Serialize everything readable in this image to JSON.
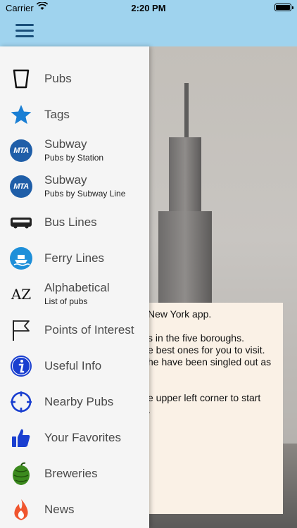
{
  "status": {
    "carrier": "Carrier",
    "time": "2:20 PM"
  },
  "nav": {
    "menu_icon": "hamburger-menu-icon"
  },
  "info_lines": [
    "New York app.",
    "",
    "s in the five boroughs.",
    "e best ones for you to visit.",
    "he have been singled out as",
    "",
    "",
    "e upper left corner to start",
    "."
  ],
  "menu": [
    {
      "label": "Pubs",
      "icon": "pint-glass-icon"
    },
    {
      "label": "Tags",
      "icon": "star-icon"
    },
    {
      "label": "Subway",
      "sub": "Pubs by Station",
      "icon": "mta-logo-icon",
      "icon_text": "MTA"
    },
    {
      "label": "Subway",
      "sub": "Pubs by Subway Line",
      "icon": "mta-logo-icon",
      "icon_text": "MTA"
    },
    {
      "label": "Bus Lines",
      "icon": "bus-icon"
    },
    {
      "label": "Ferry Lines",
      "icon": "ferry-icon"
    },
    {
      "label": "Alphabetical",
      "sub": "List of pubs",
      "icon": "alphabetical-icon",
      "icon_text": "AZ"
    },
    {
      "label": "Points of Interest",
      "icon": "flag-icon"
    },
    {
      "label": "Useful Info",
      "icon": "info-icon"
    },
    {
      "label": "Nearby Pubs",
      "icon": "crosshair-icon"
    },
    {
      "label": "Your Favorites",
      "icon": "thumbs-up-icon"
    },
    {
      "label": "Breweries",
      "icon": "hops-icon"
    },
    {
      "label": "News",
      "icon": "flame-icon"
    }
  ],
  "colors": {
    "nav_bar": "#9fd3ee",
    "drawer": "#f5f5f5",
    "accent_blue": "#1f5ea8",
    "star_blue": "#1a7fd4"
  }
}
